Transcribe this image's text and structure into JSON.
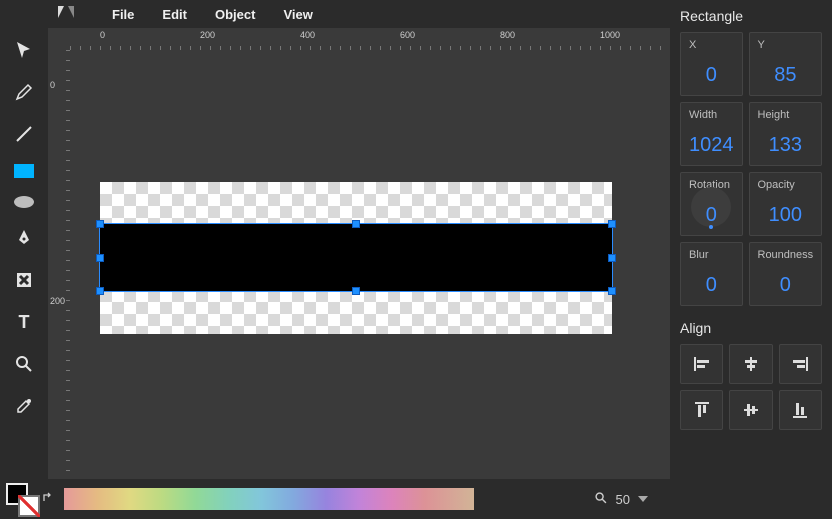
{
  "menu": {
    "file": "File",
    "edit": "Edit",
    "object": "Object",
    "view": "View"
  },
  "ruler_h": [
    "0",
    "200",
    "400",
    "600",
    "800",
    "1000"
  ],
  "ruler_v": [
    "0",
    "200"
  ],
  "inspector": {
    "title": "Rectangle",
    "x": {
      "label": "X",
      "value": "0"
    },
    "y": {
      "label": "Y",
      "value": "85"
    },
    "w": {
      "label": "Width",
      "value": "1024"
    },
    "h": {
      "label": "Height",
      "value": "133"
    },
    "rot": {
      "label": "Rotation",
      "value": "0"
    },
    "op": {
      "label": "Opacity",
      "value": "100"
    },
    "blur": {
      "label": "Blur",
      "value": "0"
    },
    "round": {
      "label": "Roundness",
      "value": "0"
    },
    "align_label": "Align"
  },
  "zoom": {
    "value": "50"
  },
  "colors": {
    "accent": "#3f8eff",
    "fill_tool": "#00b4ff"
  }
}
